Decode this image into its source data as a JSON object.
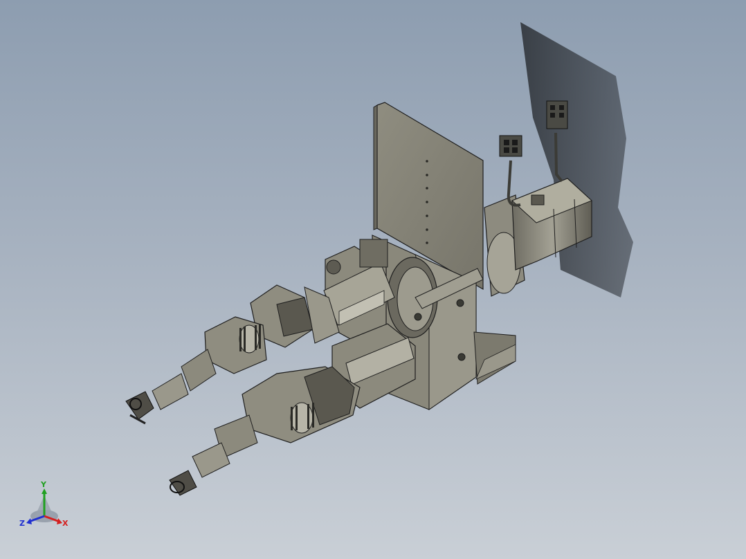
{
  "viewport": {
    "background_top": "#8d9db0",
    "background_bottom": "#c9cfd6"
  },
  "model": {
    "part_color": "#8c8a7d",
    "dark_color": "#4a4a44",
    "edge_color": "#1e1e1e",
    "shadow_color": "#33373c"
  },
  "triad": {
    "x_label": "X",
    "y_label": "Y",
    "z_label": "Z",
    "x_color": "#d42020",
    "y_color": "#20a020",
    "z_color": "#2030d0"
  }
}
